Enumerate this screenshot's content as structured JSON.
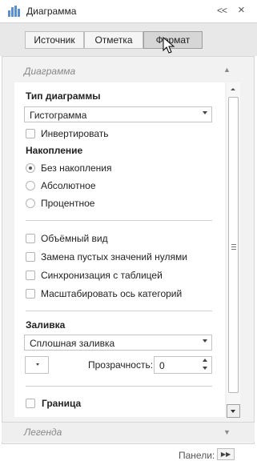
{
  "window": {
    "title": "Диаграмма",
    "collapse_label": "<<",
    "close_label": "×"
  },
  "tabs": [
    {
      "label": "Источник",
      "active": false
    },
    {
      "label": "Отметка",
      "active": false
    },
    {
      "label": "Формат",
      "active": true
    }
  ],
  "section": {
    "title": "Диаграмма",
    "arrow": "▲"
  },
  "chart_type": {
    "label": "Тип диаграммы",
    "value": "Гистограмма"
  },
  "invert": {
    "label": "Инвертировать",
    "checked": false
  },
  "stacking": {
    "label": "Накопление",
    "options": [
      {
        "label": "Без накопления",
        "checked": true
      },
      {
        "label": "Абсолютное",
        "checked": false
      },
      {
        "label": "Процентное",
        "checked": false
      }
    ]
  },
  "options": [
    {
      "label": "Объёмный вид",
      "checked": false
    },
    {
      "label": "Замена пустых значений нулями",
      "checked": false
    },
    {
      "label": "Синхронизация с таблицей",
      "checked": false
    },
    {
      "label": "Масштабировать ось категорий",
      "checked": false
    }
  ],
  "fill": {
    "label": "Заливка",
    "value": "Сплошная заливка",
    "transparency_label": "Прозрачность:",
    "transparency_value": "0"
  },
  "border": {
    "label": "Граница",
    "checked": false
  },
  "legend": {
    "title": "Легенда",
    "arrow": "▼"
  },
  "footer": {
    "label": "Панели:",
    "button": "▶▶"
  },
  "colors": {
    "accent": "#5a8fd0",
    "panel_bg": "#f2f2f2",
    "tab_active": "#d6d6d6"
  }
}
